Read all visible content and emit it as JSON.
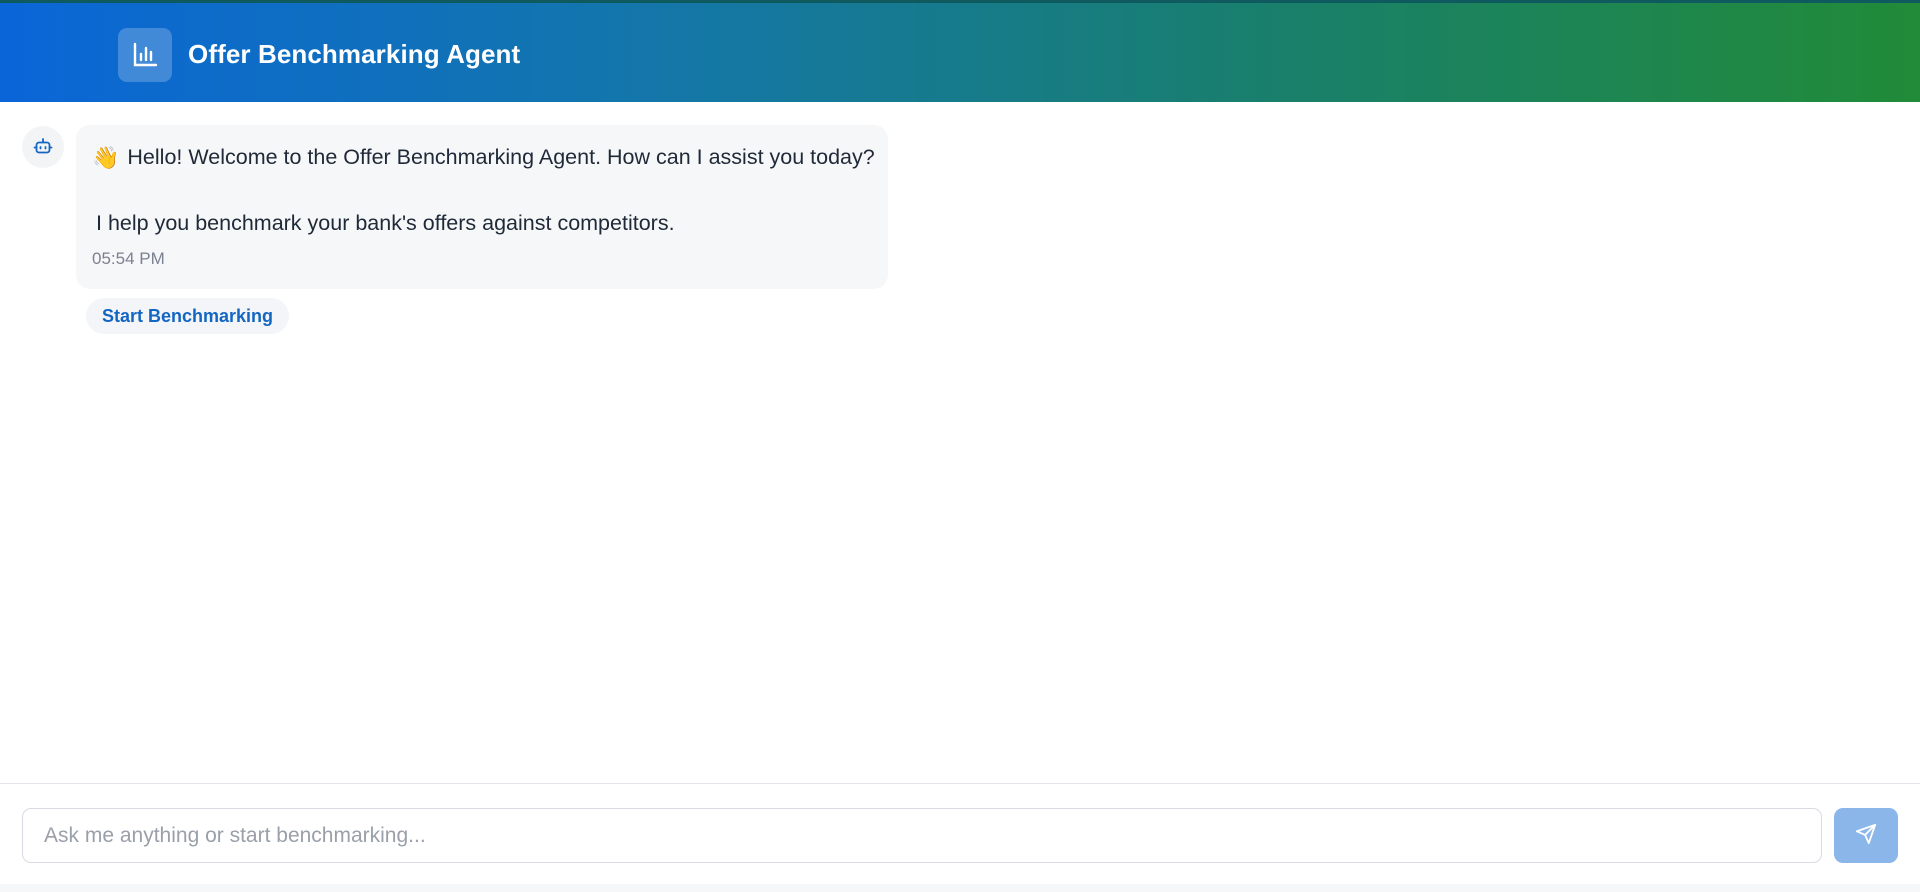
{
  "header": {
    "title": "Offer Benchmarking Agent",
    "icon": "bar-chart-icon"
  },
  "chat": {
    "messages": [
      {
        "sender": "bot",
        "avatar_icon": "robot-icon",
        "emoji": "👋",
        "line1": "Hello! Welcome to the Offer Benchmarking Agent. How can I assist you today?",
        "line2": " I help you benchmark your bank's offers against competitors.",
        "time": "05:54 PM"
      }
    ],
    "quick_action": "Start Benchmarking"
  },
  "composer": {
    "placeholder": "Ask me anything or start benchmarking...",
    "value": "",
    "send_icon": "send-icon"
  },
  "colors": {
    "header_gradient_start": "#0a66d8",
    "header_gradient_end": "#218b38",
    "accent": "#1366c2",
    "send_button": "#8bb6ea"
  }
}
